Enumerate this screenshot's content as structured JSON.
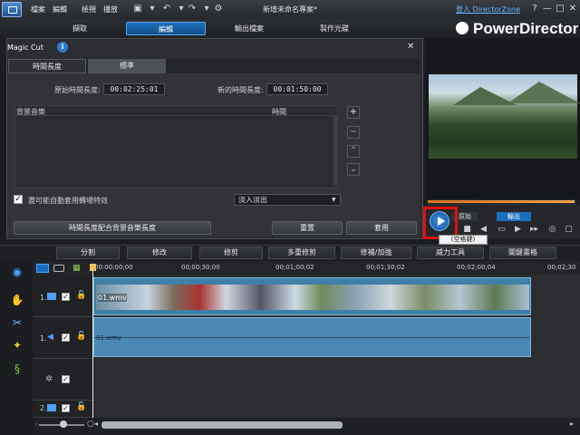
{
  "menu": [
    "檔案",
    "編輯",
    "檢視",
    "播放"
  ],
  "project_title": "新增未命名專案*",
  "sign_in": "登入 DirectorZone",
  "window_buttons": {
    "help": "?",
    "minimize": "—",
    "maximize": "□",
    "close": "✕"
  },
  "main_tabs": [
    {
      "label": "擷取"
    },
    {
      "label": "編輯",
      "active": true
    },
    {
      "label": "輸出檔案"
    },
    {
      "label": "製作光碟"
    }
  ],
  "brand": "PowerDirector",
  "dialog": {
    "title": "Magic Cut",
    "close": "✕",
    "tabs": [
      "時間長度",
      "標準"
    ],
    "original_duration_label": "原始時間長度:",
    "original_duration": "00:02:25:01",
    "new_duration_label": "新的時間長度:",
    "new_duration": "00:01:50:00",
    "col_scene": "背景音樂",
    "col_time": "時間",
    "checkbox_label": "盡可能自動套用轉場特效",
    "checkbox_checked": true,
    "transition_select": "淡入淡出",
    "match_button": "時間長度配合背景音樂長度",
    "reset_button": "重置",
    "apply_button": "套用"
  },
  "preview": {
    "mode_original": "原始",
    "mode_output": "輸出",
    "tooltip": "(空格鍵)"
  },
  "toolbar": [
    "分割",
    "修改",
    "修剪",
    "多重修剪",
    "修補/加強",
    "威力工具",
    "關鍵畫格"
  ],
  "ruler": [
    "00:00:00;00",
    "00;00;30;00",
    "00;01;00;02",
    "00;01;30;02",
    "00;02;00;04",
    "00;02;30"
  ],
  "tracks": [
    {
      "num": "1.",
      "clip": "01.wmv"
    },
    {
      "num": "1.",
      "clip": "01.wmv"
    },
    {
      "num": "",
      "clip": ""
    },
    {
      "num": "2.",
      "clip": ""
    },
    {
      "num": "",
      "clip": ""
    }
  ],
  "colors": {
    "accent": "#1c6fbf",
    "highlight": "#e01010"
  }
}
